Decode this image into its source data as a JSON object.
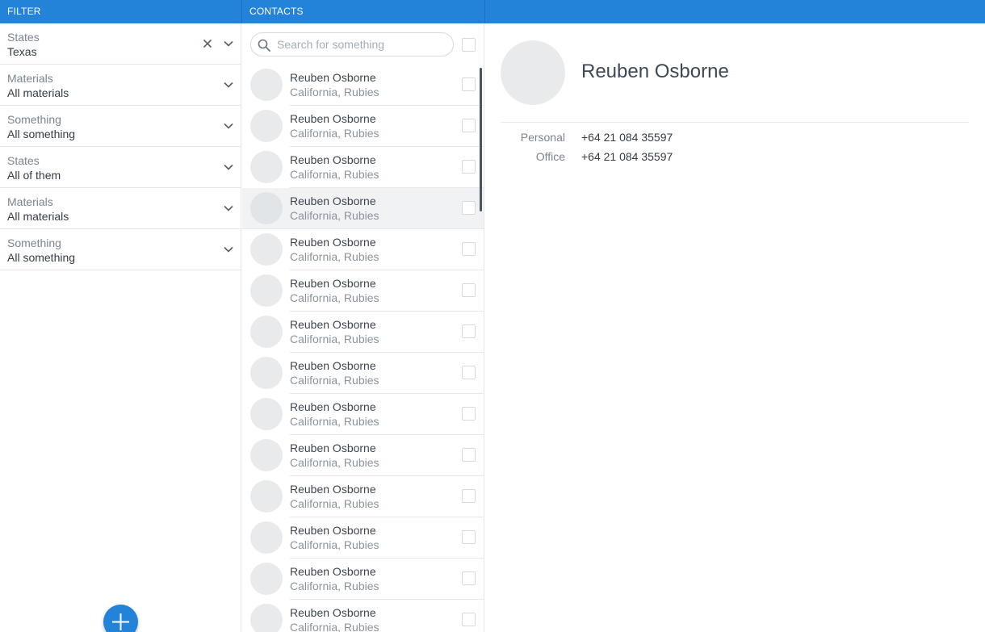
{
  "header": {
    "filter_label": "FILTER",
    "contacts_label": "CONTACTS"
  },
  "filters": [
    {
      "label": "States",
      "value": "Texas",
      "clearable": true
    },
    {
      "label": "Materials",
      "value": "All materials",
      "clearable": false
    },
    {
      "label": "Something",
      "value": "All something",
      "clearable": false
    },
    {
      "label": "States",
      "value": "All of them",
      "clearable": false
    },
    {
      "label": "Materials",
      "value": "All materials",
      "clearable": false
    },
    {
      "label": "Something",
      "value": "All something",
      "clearable": false
    }
  ],
  "search": {
    "placeholder": "Search for something",
    "value": ""
  },
  "contacts": [
    {
      "name": "Reuben Osborne",
      "subtitle": "California, Rubies"
    },
    {
      "name": "Reuben Osborne",
      "subtitle": "California, Rubies"
    },
    {
      "name": "Reuben Osborne",
      "subtitle": "California, Rubies"
    },
    {
      "name": "Reuben Osborne",
      "subtitle": "California, Rubies",
      "selected": true
    },
    {
      "name": "Reuben Osborne",
      "subtitle": "California, Rubies"
    },
    {
      "name": "Reuben Osborne",
      "subtitle": "California, Rubies"
    },
    {
      "name": "Reuben Osborne",
      "subtitle": "California, Rubies"
    },
    {
      "name": "Reuben Osborne",
      "subtitle": "California, Rubies"
    },
    {
      "name": "Reuben Osborne",
      "subtitle": "California, Rubies"
    },
    {
      "name": "Reuben Osborne",
      "subtitle": "California, Rubies"
    },
    {
      "name": "Reuben Osborne",
      "subtitle": "California, Rubies"
    },
    {
      "name": "Reuben Osborne",
      "subtitle": "California, Rubies"
    },
    {
      "name": "Reuben Osborne",
      "subtitle": "California, Rubies"
    },
    {
      "name": "Reuben Osborne",
      "subtitle": "California, Rubies"
    }
  ],
  "detail": {
    "name": "Reuben Osborne",
    "phones": [
      {
        "label": "Personal",
        "value": "+64 21 084 35597"
      },
      {
        "label": "Office",
        "value": "+64 21 084 35597"
      }
    ]
  },
  "icons": {
    "clear": "close-icon",
    "dropdown": "chevron-down-icon",
    "search": "search-icon",
    "add": "plus-icon"
  },
  "colors": {
    "accent": "#2383d8",
    "selected_row": "#f0f2f4"
  }
}
